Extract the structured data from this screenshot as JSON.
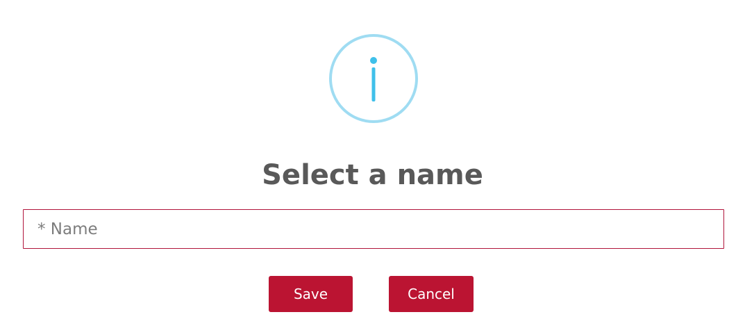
{
  "dialog": {
    "icon": "info-icon",
    "title": "Select a name",
    "name_field": {
      "placeholder": "* Name",
      "value": ""
    },
    "buttons": {
      "save_label": "Save",
      "cancel_label": "Cancel"
    }
  },
  "colors": {
    "icon_ring": "#9fdcf2",
    "icon_glyph": "#3fc0ea",
    "title": "#595959",
    "field_border": "#b0143a",
    "button_bg": "#bb1432",
    "button_text": "#ffffff"
  }
}
